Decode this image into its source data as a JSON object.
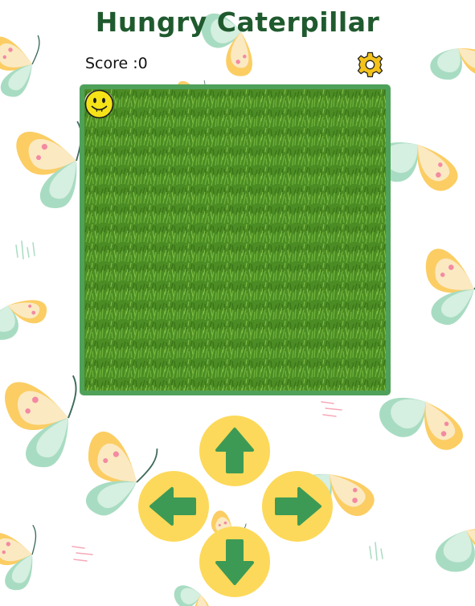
{
  "header": {
    "title": "Hungry Caterpillar",
    "score_label": "Score : ",
    "score_value": "0"
  },
  "icons": {
    "settings": "gear-icon",
    "up": "arrow-up-icon",
    "down": "arrow-down-icon",
    "left": "arrow-left-icon",
    "right": "arrow-right-icon",
    "caterpillar_head": "smiley-face-icon",
    "food": "egg-icon"
  },
  "colors": {
    "title": "#1f5a2e",
    "board_border": "#4fa15a",
    "grass": "#4a8a22",
    "button_fill": "#fcd95a",
    "arrow": "#3d9a55",
    "gear": "#f3c21b"
  }
}
